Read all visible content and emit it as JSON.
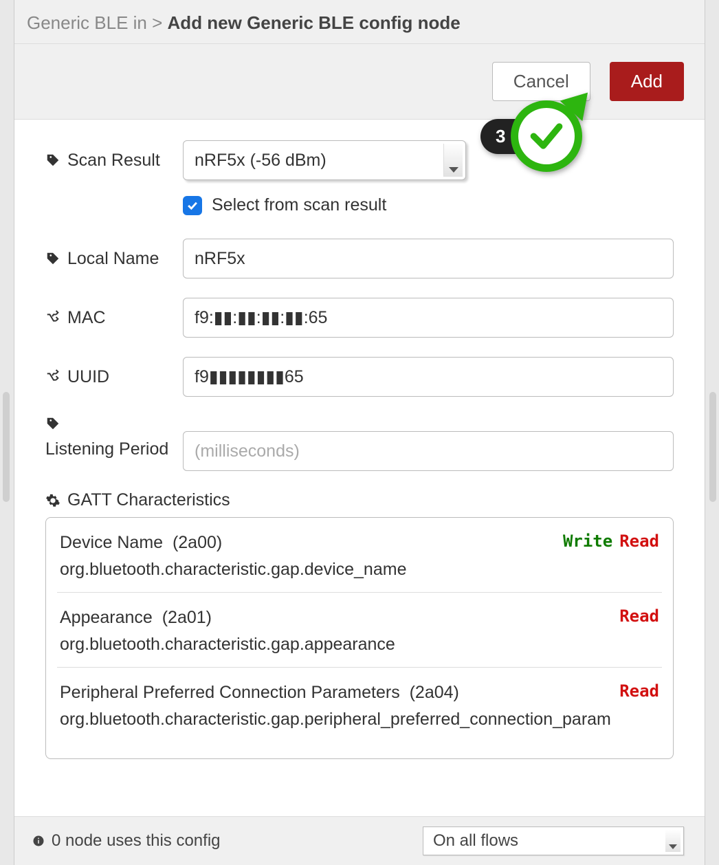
{
  "breadcrumb": {
    "parent": "Generic BLE in",
    "separator": ">",
    "current": "Add new Generic BLE config node"
  },
  "actions": {
    "cancel": "Cancel",
    "add": "Add"
  },
  "callout": {
    "step": "3"
  },
  "form": {
    "scan_result": {
      "label": "Scan Result",
      "selected": "nRF5x (-56 dBm)",
      "checkbox_label": "Select from scan result",
      "checked": true
    },
    "local_name": {
      "label": "Local Name",
      "value": "nRF5x"
    },
    "mac": {
      "label": "MAC",
      "value": "f9:▮▮:▮▮:▮▮:▮▮:65"
    },
    "uuid": {
      "label": "UUID",
      "value": "f9▮▮▮▮▮▮▮▮65"
    },
    "listening_period": {
      "label": "Listening Period",
      "placeholder": "(milliseconds)",
      "value": ""
    }
  },
  "gatt": {
    "label": "GATT Characteristics",
    "items": [
      {
        "name": "Device Name",
        "uuid": "2a00",
        "desc": "org.bluetooth.characteristic.gap.device_name",
        "write": "Write",
        "read": "Read"
      },
      {
        "name": "Appearance",
        "uuid": "2a01",
        "desc": "org.bluetooth.characteristic.gap.appearance",
        "write": "",
        "read": "Read"
      },
      {
        "name": "Peripheral Preferred Connection Parameters",
        "uuid": "2a04",
        "desc": "org.bluetooth.characteristic.gap.peripheral_preferred_connection_param",
        "write": "",
        "read": "Read"
      }
    ]
  },
  "footer": {
    "usage_text": "0 node uses this config",
    "scope_selected": "On all flows"
  }
}
